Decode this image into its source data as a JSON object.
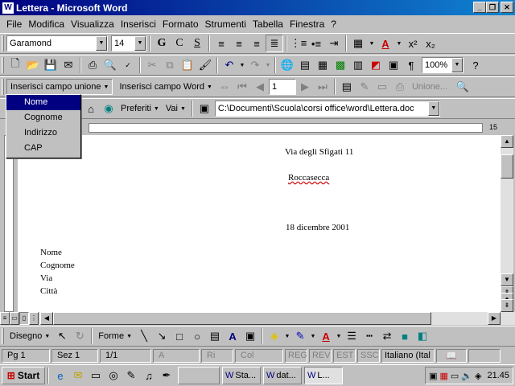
{
  "window": {
    "title": "Lettera - Microsoft Word"
  },
  "menu": [
    "File",
    "Modifica",
    "Visualizza",
    "Inserisci",
    "Formato",
    "Strumenti",
    "Tabella",
    "Finestra",
    "?"
  ],
  "format_toolbar": {
    "font": "Garamond",
    "size": "14",
    "bold": "G",
    "italic": "C",
    "underline": "S",
    "superscript": "x²",
    "subscript": "x₂"
  },
  "std_toolbar": {
    "zoom": "100%"
  },
  "mailmerge_toolbar": {
    "insert_merge_field": "Inserisci campo unione",
    "insert_word_field": "Inserisci campo Word",
    "record": "1",
    "merge_label": "Unione..."
  },
  "web_toolbar": {
    "favorites": "Preferiti",
    "go": "Vai",
    "address": "C:\\Documenti\\Scuola\\corsi office\\word\\Lettera.doc"
  },
  "merge_fields_menu": [
    "Nome",
    "Cognome",
    "Indirizzo",
    "CAP"
  ],
  "document": {
    "lines_right": [
      "Via degli Sfigati 11",
      "Roccasecca",
      "18 dicembre 2001"
    ],
    "lines_left": [
      "Nome",
      "Cognome",
      "Via",
      "Città"
    ]
  },
  "ruler": {
    "right_marker": "15"
  },
  "draw_toolbar": {
    "draw": "Disegno",
    "shapes": "Forme"
  },
  "status": {
    "page": "Pg 1",
    "section": "Sez 1",
    "pages": "1/1",
    "at": "A",
    "line": "Ri",
    "col": "Col",
    "rec": "REG",
    "rev": "REV",
    "ext": "EST",
    "ovr": "SSC",
    "language": "Italiano (Ital"
  },
  "taskbar": {
    "start": "Start",
    "tasks": [
      "Sta...",
      "dat...",
      "L..."
    ],
    "clock": "21.45"
  }
}
